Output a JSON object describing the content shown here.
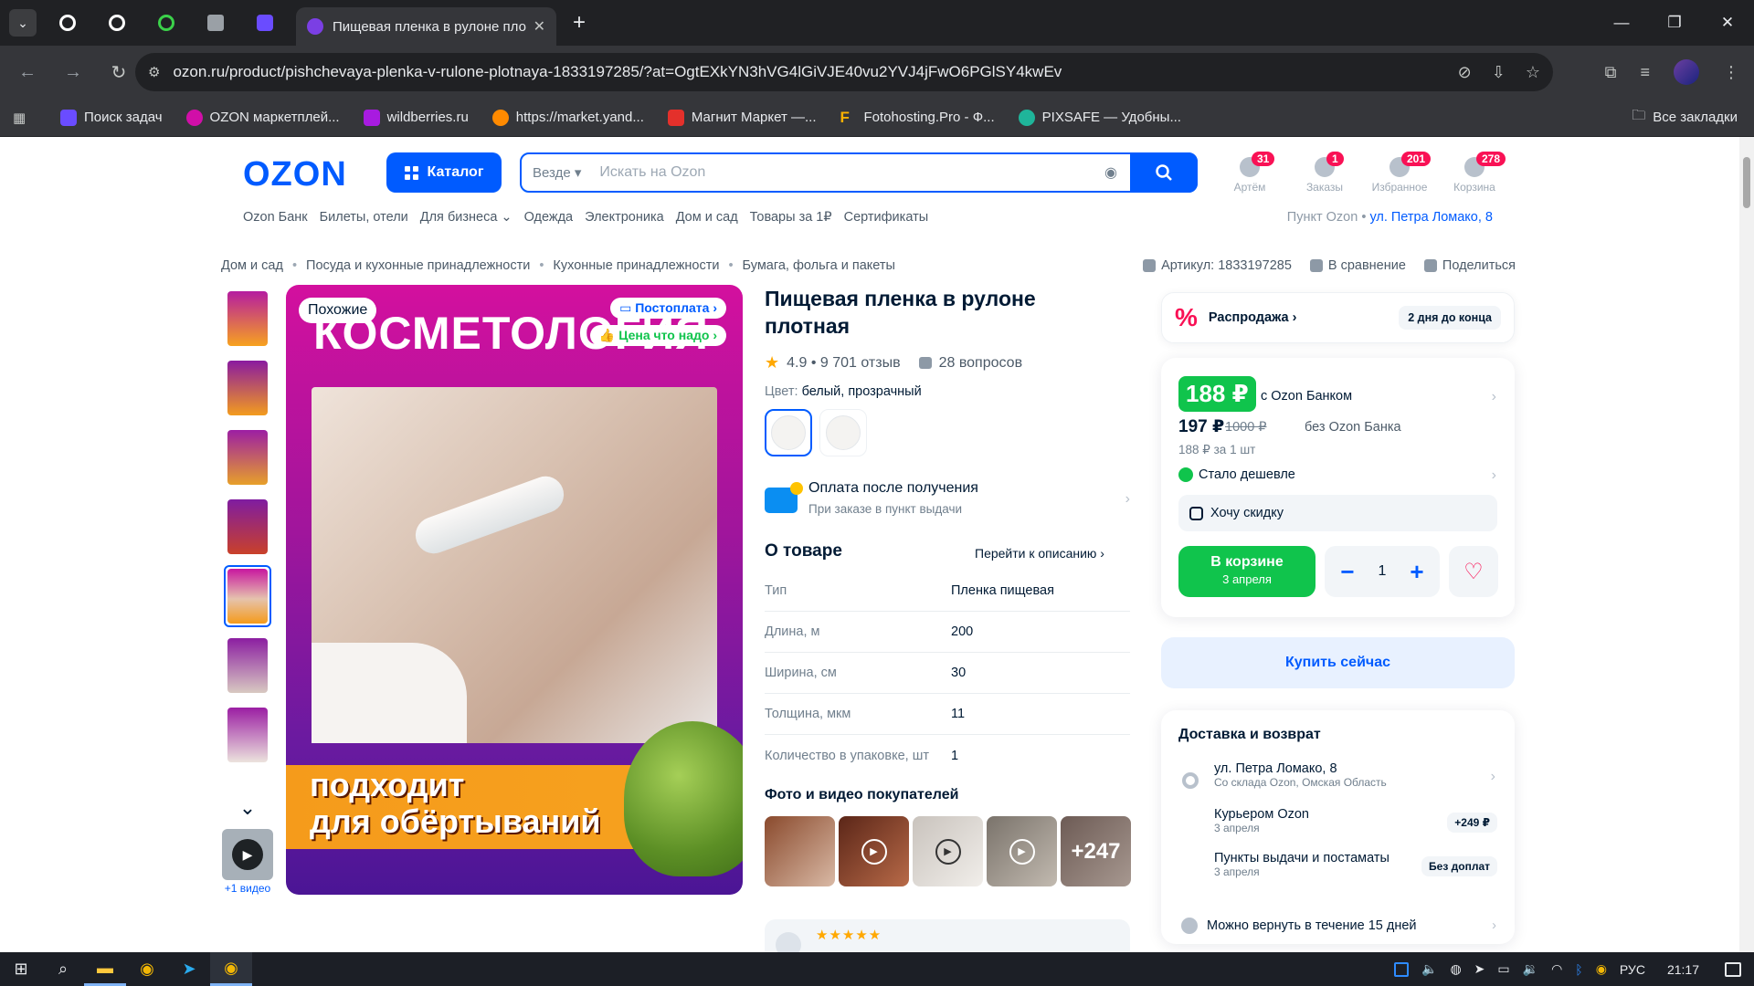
{
  "browser": {
    "tab_title": "Пищевая пленка в рулоне пло",
    "url": "ozon.ru/product/pishchevaya-plenka-v-rulone-plotnaya-1833197285/?at=OgtEXkYN3hVG4lGiVJE40vu2YVJ4jFwO6PGlSY4kwEv",
    "bookmarks": [
      "Поиск задач",
      "OZON маркетплей...",
      "wildberries.ru",
      "https://market.yand...",
      "Магнит Маркет —...",
      "Fotohosting.Pro - Ф...",
      "PIXSAFE — Удобны..."
    ],
    "bookmarks_all": "Все закладки"
  },
  "header": {
    "logo": "OZON",
    "catalog_label": "Каталог",
    "search_scope": "Везде",
    "search_placeholder": "Искать на Ozon",
    "icons": [
      {
        "label": "Артём",
        "badge": "31"
      },
      {
        "label": "Заказы",
        "badge": "1"
      },
      {
        "label": "Избранное",
        "badge": "201"
      },
      {
        "label": "Корзина",
        "badge": "278"
      }
    ],
    "subnav": [
      "Ozon Банк",
      "Билеты, отели",
      "Для бизнеса",
      "Одежда",
      "Электроника",
      "Дом и сад",
      "Товары за 1₽",
      "Сертификаты"
    ],
    "pickup_label": "Пункт Ozon •",
    "pickup_address": "ул. Петра Ломако, 8"
  },
  "breadcrumbs": [
    "Дом и сад",
    "Посуда и кухонные принадлежности",
    "Кухонные принадлежности",
    "Бумага, фольга и пакеты"
  ],
  "top_actions": {
    "article": "Артикул: 1833197285",
    "compare": "В сравнение",
    "share": "Поделиться"
  },
  "gallery": {
    "similar_chip": "Похожие",
    "postpay_chip": "Постоплата",
    "price_chip": "Цена что надо",
    "headline": "КОСМЕТОЛОГИЯ",
    "banner_line1": "подходит",
    "banner_line2": "для обёртываний",
    "video_caption": "+1 видео"
  },
  "product": {
    "title": "Пищевая пленка в рулоне плотная",
    "rating": "4.9 • 9 701 отзыв",
    "questions": "28 вопросов",
    "color_label": "Цвет:",
    "color_value": "белый, прозрачный",
    "pay_title": "Оплата после получения",
    "pay_subtitle": "При заказе в пункт выдачи",
    "about_title": "О товаре",
    "about_link": "Перейти к описанию",
    "specs": [
      {
        "k": "Тип",
        "v": "Пленка пищевая"
      },
      {
        "k": "Длина, м",
        "v": "200"
      },
      {
        "k": "Ширина, см",
        "v": "30"
      },
      {
        "k": "Толщина, мкм",
        "v": "11"
      },
      {
        "k": "Количество в упаковке, шт",
        "v": "1"
      }
    ],
    "photos_title": "Фото и видео покупателей",
    "photos_more": "+247"
  },
  "sale": {
    "label": "Распродажа",
    "days_left": "2 дня до конца"
  },
  "price": {
    "main": "188 ₽",
    "main_label": "с Ozon Банком",
    "alt": "197 ₽",
    "old": "1000 ₽",
    "alt_label": "без Ozon Банка",
    "unit": "188 ₽ за 1 шт",
    "cheaper": "Стало дешевле",
    "discount": "Хочу скидку",
    "cart_label": "В корзине",
    "cart_date": "3 апреля",
    "quantity": "1",
    "buy_now": "Купить сейчас"
  },
  "delivery": {
    "title": "Доставка и возврат",
    "rows": [
      {
        "t": "ул. Петра Ломако, 8",
        "s": "Со склада Ozon, Омская Область",
        "tag": ""
      },
      {
        "t": "Курьером Ozon",
        "s": "3 апреля",
        "tag": "+249 ₽"
      },
      {
        "t": "Пункты выдачи и постаматы",
        "s": "3 апреля",
        "tag": "Без доплат"
      }
    ],
    "return": "Можно вернуть в течение 15 дней"
  },
  "taskbar": {
    "lang": "РУС",
    "time": "21:17"
  },
  "colors": {
    "brand": "#005bff",
    "green": "#10c44c",
    "pink": "#f91155"
  }
}
